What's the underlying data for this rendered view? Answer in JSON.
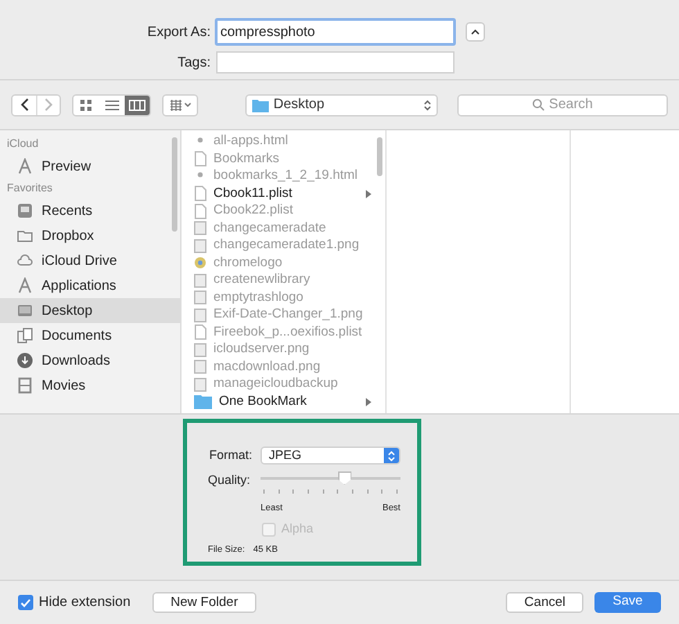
{
  "export_as": {
    "label": "Export As:",
    "value": "compressphoto"
  },
  "tags": {
    "label": "Tags:"
  },
  "toolbar": {
    "views": [
      {
        "kind": "icons",
        "selected": false
      },
      {
        "kind": "list",
        "selected": false
      },
      {
        "kind": "columns",
        "selected": true
      }
    ],
    "location": "Desktop",
    "search": {
      "placeholder": "Search"
    }
  },
  "sidebar": {
    "sections": [
      {
        "title": "iCloud",
        "items": [
          {
            "label": "Preview",
            "kind": "app",
            "selected": false
          }
        ]
      },
      {
        "title": "Favorites",
        "items": [
          {
            "label": "Recents",
            "kind": "recents",
            "selected": false
          },
          {
            "label": "Dropbox",
            "kind": "folder",
            "selected": false
          },
          {
            "label": "iCloud Drive",
            "kind": "cloud",
            "selected": false
          },
          {
            "label": "Applications",
            "kind": "app",
            "selected": false
          },
          {
            "label": "Desktop",
            "kind": "desktop",
            "selected": true
          },
          {
            "label": "Documents",
            "kind": "documents",
            "selected": false
          },
          {
            "label": "Downloads",
            "kind": "download",
            "selected": false
          },
          {
            "label": "Movies",
            "kind": "movie",
            "selected": false
          }
        ]
      }
    ]
  },
  "files": [
    {
      "name": "all-apps.html",
      "kind": "html",
      "disabled": true,
      "expandable": false
    },
    {
      "name": "Bookmarks",
      "kind": "doc",
      "disabled": true,
      "expandable": false
    },
    {
      "name": "bookmarks_1_2_19.html",
      "kind": "html",
      "disabled": true,
      "expandable": false
    },
    {
      "name": "Cbook11.plist",
      "kind": "doc",
      "disabled": false,
      "expandable": true
    },
    {
      "name": "Cbook22.plist",
      "kind": "doc",
      "disabled": true,
      "expandable": false
    },
    {
      "name": "changecameradate",
      "kind": "image",
      "disabled": true,
      "expandable": false
    },
    {
      "name": "changecameradate1.png",
      "kind": "image",
      "disabled": true,
      "expandable": false
    },
    {
      "name": "chromelogo",
      "kind": "logo",
      "disabled": true,
      "expandable": false
    },
    {
      "name": "createnewlibrary",
      "kind": "image",
      "disabled": true,
      "expandable": false
    },
    {
      "name": "emptytrashlogo",
      "kind": "image",
      "disabled": true,
      "expandable": false
    },
    {
      "name": "Exif-Date-Changer_1.png",
      "kind": "image",
      "disabled": true,
      "expandable": false
    },
    {
      "name": "Fireebok_p...oexifios.plist",
      "kind": "doc",
      "disabled": true,
      "expandable": false
    },
    {
      "name": "icloudserver.png",
      "kind": "image",
      "disabled": true,
      "expandable": false
    },
    {
      "name": "macdownload.png",
      "kind": "image",
      "disabled": true,
      "expandable": false
    },
    {
      "name": "manageicloudbackup",
      "kind": "image",
      "disabled": true,
      "expandable": false
    },
    {
      "name": "One BookMark",
      "kind": "folder",
      "disabled": false,
      "expandable": true
    }
  ],
  "options": {
    "format": {
      "label": "Format:",
      "value": "JPEG"
    },
    "quality": {
      "label": "Quality:",
      "level": 0.6,
      "min_label": "Least",
      "max_label": "Best"
    },
    "alpha": {
      "label": "Alpha",
      "checked": false,
      "disabled": true
    },
    "file_size": {
      "label": "File Size:",
      "value": "45 KB"
    }
  },
  "hide_extension": {
    "label": "Hide extension",
    "checked": true
  },
  "buttons": [
    {
      "label": "New Folder",
      "kind": "secondary"
    },
    {
      "label": "Cancel",
      "kind": "secondary"
    },
    {
      "label": "Save",
      "kind": "primary"
    }
  ]
}
